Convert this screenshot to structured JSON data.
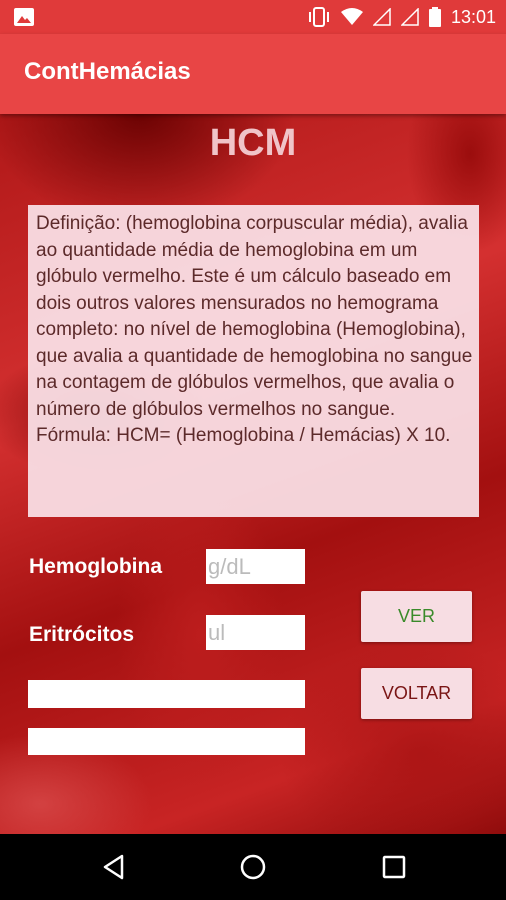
{
  "status_bar": {
    "time": "13:01",
    "icons": [
      "image-icon",
      "vibrate-icon",
      "wifi-icon",
      "signal-icon",
      "signal-icon",
      "battery-icon"
    ]
  },
  "app": {
    "title": "ContHemácias"
  },
  "page": {
    "title": "HCM",
    "definition": "Definição: (hemoglobina corpuscular média), avalia ao quantidade média de hemoglobina em um glóbulo vermelho. Este é um cálculo baseado em dois outros valores mensurados no hemograma completo: no nível de hemoglobina (Hemoglobina), que avalia a quantidade de hemoglobina no sangue na contagem de glóbulos vermelhos, que avalia o número de glóbulos vermelhos no sangue. Fórmula: HCM= (Hemoglobina / Hemácias) X 10."
  },
  "form": {
    "hemoglobina": {
      "label": "Hemoglobina",
      "placeholder": "g/dL",
      "value": ""
    },
    "eritrocitos": {
      "label": "Eritrócitos",
      "placeholder": "ul",
      "value": ""
    },
    "result1": {
      "value": ""
    },
    "result2": {
      "value": ""
    }
  },
  "buttons": {
    "ver": "VER",
    "voltar": "VOLTAR"
  },
  "colors": {
    "status_bar": "#e03a3a",
    "app_bar": "#e84545",
    "button_bg": "#f7dde3",
    "ver_text": "#3a8a2a",
    "voltar_text": "#7a1515"
  },
  "nav": {
    "icons": [
      "back-icon",
      "home-icon",
      "recents-icon"
    ]
  }
}
